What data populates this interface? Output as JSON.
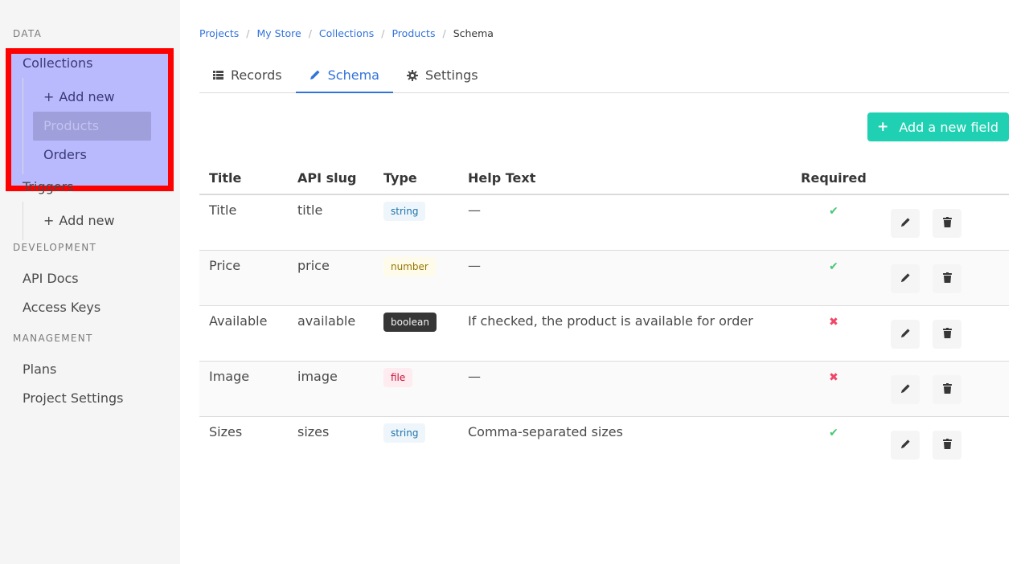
{
  "sidebar": {
    "sections": [
      {
        "label": "DATA",
        "items": [
          {
            "label": "Collections",
            "children": [
              {
                "label": "Add new",
                "prefix": "+"
              },
              {
                "label": "Products",
                "active": true
              },
              {
                "label": "Orders"
              }
            ]
          },
          {
            "label": "Triggers",
            "children": [
              {
                "label": "Add new",
                "prefix": "+"
              }
            ]
          }
        ]
      },
      {
        "label": "DEVELOPMENT",
        "items": [
          {
            "label": "API Docs"
          },
          {
            "label": "Access Keys"
          }
        ]
      },
      {
        "label": "MANAGEMENT",
        "items": [
          {
            "label": "Plans"
          },
          {
            "label": "Project Settings"
          }
        ]
      }
    ]
  },
  "breadcrumb": {
    "items": [
      "Projects",
      "My Store",
      "Collections",
      "Products"
    ],
    "current": "Schema",
    "separator": "/"
  },
  "tabs": [
    {
      "label": "Records",
      "icon": "list-icon"
    },
    {
      "label": "Schema",
      "icon": "pencil-icon",
      "active": true
    },
    {
      "label": "Settings",
      "icon": "gear-icon"
    }
  ],
  "toolbar": {
    "add_field_label": "Add a new field",
    "add_field_prefix": "+"
  },
  "table": {
    "headers": [
      "Title",
      "API slug",
      "Type",
      "Help Text",
      "Required"
    ],
    "rows": [
      {
        "title": "Title",
        "slug": "title",
        "type": "string",
        "help": "—",
        "required": true
      },
      {
        "title": "Price",
        "slug": "price",
        "type": "number",
        "help": "—",
        "required": true
      },
      {
        "title": "Available",
        "slug": "available",
        "type": "boolean",
        "help": "If checked, the product is available for order",
        "required": false
      },
      {
        "title": "Image",
        "slug": "image",
        "type": "file",
        "help": "—",
        "required": false
      },
      {
        "title": "Sizes",
        "slug": "sizes",
        "type": "string",
        "help": "Comma-separated sizes",
        "required": true
      }
    ],
    "required_yes_glyph": "✔",
    "required_no_glyph": "✖"
  },
  "colors": {
    "primary": "#1fd1b2",
    "link": "#3273dc",
    "highlight_border": "#ff0000",
    "highlight_fill": "#aaaaff"
  }
}
